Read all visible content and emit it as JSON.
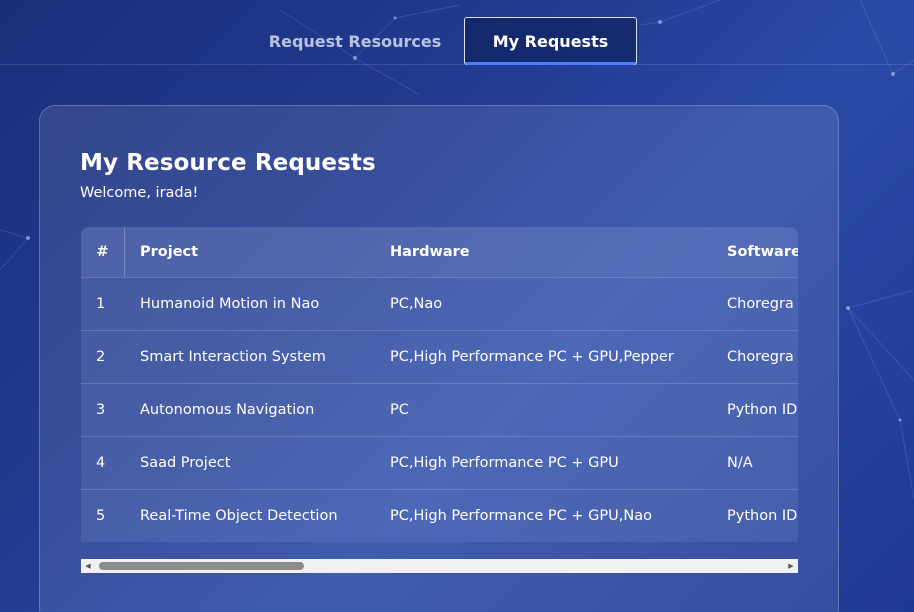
{
  "nav": {
    "tabs": [
      {
        "label": "Request Resources",
        "active": false
      },
      {
        "label": "My Requests",
        "active": true
      }
    ]
  },
  "main": {
    "title": "My Resource Requests",
    "welcome": "Welcome, irada!"
  },
  "table": {
    "headers": [
      "#",
      "Project",
      "Hardware",
      "Software"
    ],
    "rows": [
      {
        "num": "1",
        "project": "Humanoid Motion in Nao",
        "hardware": "PC,Nao",
        "software": "Choregra"
      },
      {
        "num": "2",
        "project": "Smart Interaction System",
        "hardware": "PC,High Performance PC + GPU,Pepper",
        "software": "Choregra"
      },
      {
        "num": "3",
        "project": "Autonomous Navigation",
        "hardware": "PC",
        "software": "Python ID"
      },
      {
        "num": "4",
        "project": "Saad Project",
        "hardware": "PC,High Performance PC + GPU",
        "software": "N/A"
      },
      {
        "num": "5",
        "project": "Real-Time Object Detection",
        "hardware": "PC,High Performance PC + GPU,Nao",
        "software": "Python ID"
      }
    ]
  },
  "colors": {
    "background": "#223a8f",
    "active_tab_underline": "#4c7dff"
  }
}
